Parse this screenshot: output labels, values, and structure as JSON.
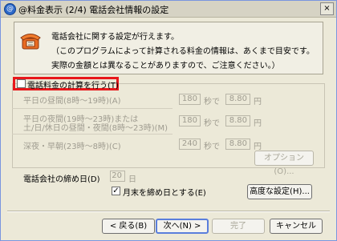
{
  "window": {
    "title": "@料金表示 (2/4) 電話会社情報の設定",
    "title_icon": "@",
    "close_glyph": "×"
  },
  "info": {
    "line1": "電話会社に関する設定が行えます。",
    "line2": "（このプログラムによって計算される料金の情報は、あくまで目安です。",
    "line3": "実際の金額とは異なることがありますので、ご注意ください。）"
  },
  "calc": {
    "checkbox_label": "電話料金の計算を行う(T)",
    "checked": false,
    "rows": [
      {
        "label1": "平日の昼間(8時～19時)(A)",
        "label2": "",
        "seconds": "180",
        "unit_sec": "秒で",
        "yen": "8.80",
        "unit_yen": "円"
      },
      {
        "label1": "平日の夜間(19時～23時)または",
        "label2": "土/日/休日の昼間・夜間(8時～23時)(M)",
        "seconds": "180",
        "unit_sec": "秒で",
        "yen": "8.80",
        "unit_yen": "円"
      },
      {
        "label1": "深夜・早朝(23時～8時)(C)",
        "label2": "",
        "seconds": "240",
        "unit_sec": "秒で",
        "yen": "8.80",
        "unit_yen": "円"
      }
    ],
    "options_button": "オプション(O)..."
  },
  "closing": {
    "label": "電話会社の締め日(D)",
    "day_value": "20",
    "day_unit": "日",
    "month_end_label": "月末を締め日とする(E)",
    "month_end_checked": true,
    "advanced_button": "高度な設定(H)..."
  },
  "nav": {
    "back": "< 戻る(B)",
    "next": "次へ(N) >",
    "finish": "完了",
    "cancel": "キャンセル"
  },
  "colors": {
    "highlight_frame": "#e8171b",
    "window_bg": "#ece9d8"
  }
}
